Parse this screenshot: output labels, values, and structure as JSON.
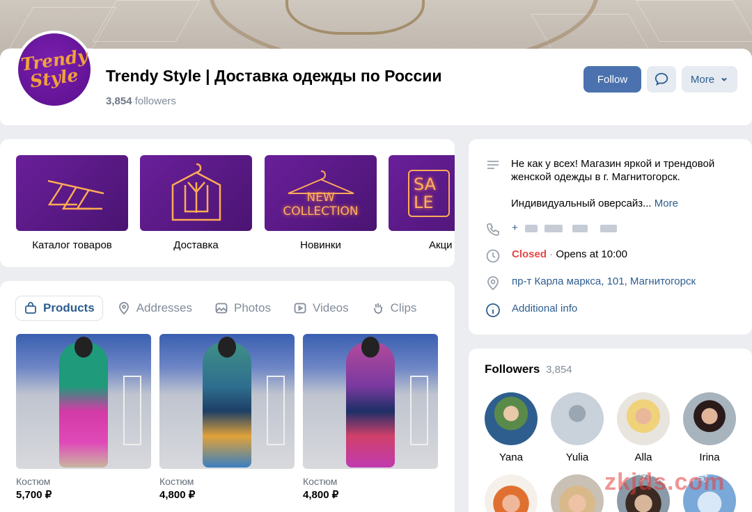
{
  "group": {
    "avatar_text_1": "Trendy",
    "avatar_text_2": "Style",
    "title": "Trendy Style | Доставка одежды по России",
    "followers_count": "3,854",
    "followers_word": "followers"
  },
  "actions": {
    "follow_label": "Follow",
    "more_label": "More"
  },
  "albums": [
    {
      "label": "Каталог товаров",
      "art": ""
    },
    {
      "label": "Доставка",
      "art": ""
    },
    {
      "label": "Новинки",
      "art": "NEW COLLECTION"
    },
    {
      "label": "Акци",
      "art": "SA LE"
    }
  ],
  "tabs": [
    {
      "label": "Products"
    },
    {
      "label": "Addresses"
    },
    {
      "label": "Photos"
    },
    {
      "label": "Videos"
    },
    {
      "label": "Clips"
    }
  ],
  "products": [
    {
      "title": "Костюм",
      "price": "5,700 ₽"
    },
    {
      "title": "Костюм",
      "price": "4,800 ₽"
    },
    {
      "title": "Костюм",
      "price": "4,800 ₽"
    }
  ],
  "info": {
    "description_1": "Не как у всех! Магазин яркой и трендовой женской одежды в г. Магнитогорск.",
    "description_2": "Индивидуальный оверсайз...",
    "more_link": "More",
    "phone_prefix": "+",
    "status_closed": "Closed",
    "status_separator": " · ",
    "status_opens": "Opens at 10:00",
    "address": "пр-т Карла маркса, 101, Магнитогорск",
    "additional": "Additional info"
  },
  "followers": {
    "title": "Followers",
    "count": "3,854",
    "people": [
      {
        "name": "Yana"
      },
      {
        "name": "Yulia"
      },
      {
        "name": "Alla"
      },
      {
        "name": "Irina"
      }
    ]
  },
  "watermark": {
    "text": "zkjds.com",
    "sub": "外贸长志哥"
  },
  "colors": {
    "accent": "#4b72ae",
    "link": "#2c5c8f",
    "closed": "#e64646",
    "album_bg": "#5a1a88"
  }
}
